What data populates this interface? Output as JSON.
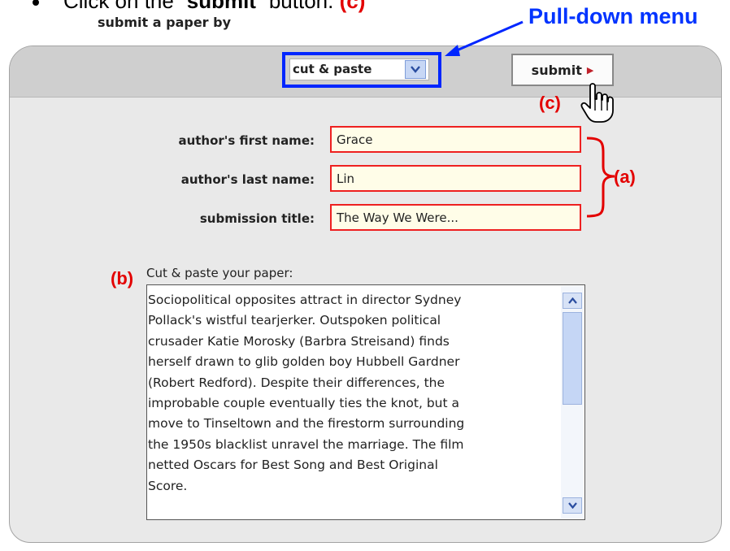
{
  "instruction": {
    "prefix": "Click on the “",
    "keyword": "submit",
    "suffix": "” button.",
    "marker": "(c)"
  },
  "callouts": {
    "pulldown": "Pull-down menu",
    "a": "(a)",
    "b": "(b)",
    "c": "(c)"
  },
  "form": {
    "submit_by_label": "submit a paper by",
    "submit_by_selected": "cut & paste",
    "submit_button": "submit",
    "first_name_label": "author's first name:",
    "first_name_value": "Grace",
    "last_name_label": "author's last name:",
    "last_name_value": "Lin",
    "title_label": "submission title:",
    "title_value": "The Way We Were...",
    "paste_label": "Cut & paste your paper:",
    "paper_text": "Sociopolitical opposites attract in director Sydney Pollack's wistful tearjerker. Outspoken political crusader Katie Morosky (Barbra Streisand) finds herself drawn to glib golden boy Hubbell Gardner (Robert Redford). Despite their differences, the improbable couple eventually ties the knot, but a move to Tinseltown and the firestorm surrounding the 1950s blacklist unravel the marriage. The film netted Oscars for Best Song and Best Original Score.",
    "paper_lines": [
      "Sociopolitical opposites attract in director Sydney",
      "Pollack's wistful tearjerker. Outspoken political",
      "crusader Katie Morosky (Barbra Streisand) finds",
      "herself drawn to glib golden boy Hubbell Gardner",
      "(Robert Redford). Despite their differences, the",
      "improbable couple eventually ties the knot, but a",
      "move to Tinseltown and the firestorm surrounding",
      "the 1950s blacklist unravel the marriage. The film",
      "netted Oscars for Best Song and Best Original",
      "Score."
    ]
  },
  "colors": {
    "annotation_red": "#e30000",
    "annotation_blue": "#0033ff",
    "input_border": "#ee2020",
    "input_bg": "#fffde8"
  },
  "icons": {
    "dropdown": "chevron-down-icon",
    "submit_arrow": "triangle-right-icon",
    "cursor": "hand-pointer-icon",
    "scroll_up": "chevron-up-icon",
    "scroll_down": "chevron-down-icon"
  }
}
